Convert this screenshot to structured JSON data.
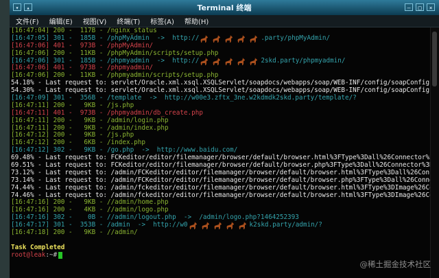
{
  "window": {
    "title": "Terminal 终端",
    "menu": [
      "文件(F)",
      "编辑(E)",
      "视图(V)",
      "终端(T)",
      "标签(A)",
      "帮助(H)"
    ]
  },
  "terminal": {
    "lines": [
      {
        "kind": "req",
        "time": "[16:47:04]",
        "code": "200",
        "size": "117B",
        "path": "/nginx_status",
        "tone": "normal"
      },
      {
        "kind": "req_redirect",
        "time": "[16:47:05]",
        "code": "301",
        "size": "185B",
        "path": "/phpMyAdmin  ->  http://",
        "redacted": {
          "count": 5
        },
        "tail": ".party/phpMyAdmin/",
        "tone": "redir"
      },
      {
        "kind": "req",
        "time": "[16:47:06]",
        "code": "401",
        "size": "973B",
        "path": "/phpMyAdmin/",
        "tone": "red"
      },
      {
        "kind": "req",
        "time": "[16:47:06]",
        "code": "200",
        "size": "11KB",
        "path": "/phpMyAdmin/scripts/setup.php",
        "tone": "normal"
      },
      {
        "kind": "req_redirect",
        "time": "[16:47:06]",
        "code": "301",
        "size": "185B",
        "path": "/phpmyadmin  ->  http://",
        "redacted": {
          "count": 5
        },
        "tail": "2skd.party/phpmyadmin/",
        "tone": "redir"
      },
      {
        "kind": "req",
        "time": "[16:47:06]",
        "code": "401",
        "size": "973B",
        "path": "/phpmyadmin/",
        "tone": "red"
      },
      {
        "kind": "req",
        "time": "[16:47:06]",
        "code": "200",
        "size": "11KB",
        "path": "/phpmyadmin/scripts/setup.php",
        "tone": "normal"
      },
      {
        "kind": "progress",
        "text": "54.18% - Last request to: servlet/Oracle.xml.xsql.XSQLServlet/soapdocs/webapps/soap/WEB-INF/config/soapConfig.x"
      },
      {
        "kind": "progress",
        "text": "54.30% - Last request to: servlet/Oracle.xml.xsql.XSQLServlet/soapdocs/webapps/soap/WEB-INF/config/soapConfig.x"
      },
      {
        "kind": "req_redirect_full",
        "time": "[16:47:09]",
        "code": "301",
        "size": "356B",
        "path": "/template  ->  http://w00e3.zftx_3ne.w2kdmdk2skd.party/template/?",
        "tone": "redir"
      },
      {
        "kind": "req",
        "time": "[16:47:11]",
        "code": "200",
        "size": "9KB",
        "path": "/js.php",
        "tone": "normal"
      },
      {
        "kind": "req",
        "time": "[16:47:11]",
        "code": "401",
        "size": "973B",
        "path": "/phpmyadmin/db_create.php",
        "tone": "red"
      },
      {
        "kind": "req",
        "time": "[16:47:11]",
        "code": "200",
        "size": "9KB",
        "path": "/admin/login.php",
        "tone": "normal"
      },
      {
        "kind": "req",
        "time": "[16:47:11]",
        "code": "200",
        "size": "9KB",
        "path": "/admin/index.php",
        "tone": "normal"
      },
      {
        "kind": "req",
        "time": "[16:47:12]",
        "code": "200",
        "size": "9KB",
        "path": "/js.php",
        "tone": "normal"
      },
      {
        "kind": "req",
        "time": "[16:47:12]",
        "code": "200",
        "size": "6KB",
        "path": "/index.php",
        "tone": "normal"
      },
      {
        "kind": "req_redirect_full",
        "time": "[16:47:12]",
        "code": "302",
        "size": "9KB",
        "path": "/go.php  ->  http://www.baidu.com/",
        "tone": "redir"
      },
      {
        "kind": "progress",
        "text": "69.48% - Last request to: FCKeditor/editor/filemanager/browser/default/browser.html%3FType%3Dall%26Connector%3D"
      },
      {
        "kind": "progress",
        "text": "69.51% - Last request to: FCKeditor/editor/filemanager/browser/default/browser.php%3FType%3Dall%26Connector%3D"
      },
      {
        "kind": "progress",
        "text": "73.12% - Last request to: /admin/FCKeditor/editor/filemanager/browser/default/browser.html%3FType%3Dall%26Conne"
      },
      {
        "kind": "progress",
        "text": "73.14% - Last request to: /admin/FCKeditor/editor/filemanager/browser/default/browser.php%3FType%3Dall%26Connec"
      },
      {
        "kind": "progress",
        "text": "74.44% - Last request to: /admin/fckeditor/editor/filemanager/browser/default/browser.html%3FType%3DImage%26Con"
      },
      {
        "kind": "progress",
        "text": "74.46% - Last request to: /admin/fckeditor/editor/filemanager/browser/default/browser.html%3FType%3DImage%26Con"
      },
      {
        "kind": "req",
        "time": "[16:47:16]",
        "code": "200",
        "size": "9KB",
        "path": "//admin/home.php",
        "tone": "normal"
      },
      {
        "kind": "req",
        "time": "[16:47:16]",
        "code": "200",
        "size": "4KB",
        "path": "//admin/logo.php",
        "tone": "normal"
      },
      {
        "kind": "req_redirect_full",
        "time": "[16:47:16]",
        "code": "302",
        "size": "0B",
        "path": "//admin/logout.php  ->  /admin/logo.php?1464252393",
        "tone": "redir"
      },
      {
        "kind": "req_redirect",
        "time": "[16:47:17]",
        "code": "301",
        "size": "353B",
        "path": "/admin  ->  http://w0",
        "redacted": {
          "count": 5
        },
        "tail": "k2skd.party/admin/?",
        "tone": "redir"
      },
      {
        "kind": "req",
        "time": "[16:47:18]",
        "code": "200",
        "size": "9KB",
        "path": "//admin/",
        "tone": "normal"
      },
      {
        "kind": "blank"
      },
      {
        "kind": "status",
        "text": "Task Completed"
      },
      {
        "kind": "prompt",
        "user": "root@leak",
        "path": ":~#"
      }
    ]
  },
  "watermark": "@稀土掘金技术社区",
  "colors": {
    "time": "#9aa8ae",
    "teal": "#34a4ad",
    "green": "#8bb532",
    "red": "#d5434b",
    "white": "#eaeaea",
    "yellow": "#f0e55e",
    "cursor": "#26c426"
  }
}
